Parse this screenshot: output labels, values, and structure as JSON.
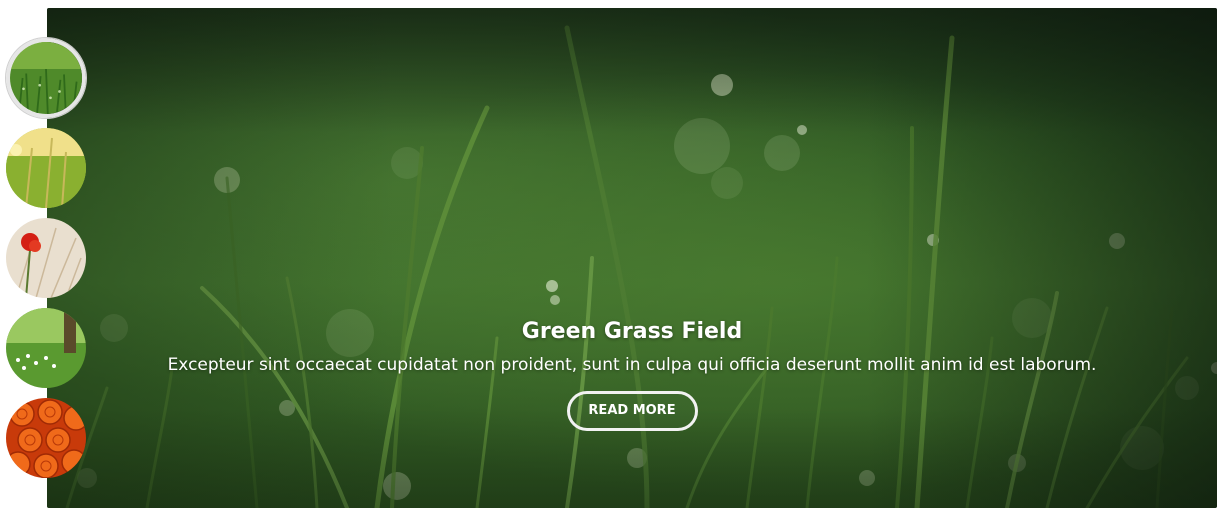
{
  "slider": {
    "active_index": 0,
    "slide": {
      "title": "Green Grass Field",
      "description": "Excepteur sint occaecat cupidatat non proident, sunt in culpa qui officia deserunt mollit anim id est laborum.",
      "button_label": "READ MORE",
      "image_subject": "green-grass-field"
    },
    "thumbnails": [
      {
        "subject": "green-grass-dew",
        "active": true
      },
      {
        "subject": "wheat-field",
        "active": false
      },
      {
        "subject": "red-poppy-flower",
        "active": false
      },
      {
        "subject": "white-flower-meadow",
        "active": false
      },
      {
        "subject": "orange-roses",
        "active": false
      }
    ]
  },
  "colors": {
    "button_border": "#f2f2f2",
    "caption_text": "#ffffff",
    "active_thumb_ring": "#e6e6e6",
    "grass_dark": "#1f3a1c",
    "grass_mid": "#3a6a2a"
  }
}
